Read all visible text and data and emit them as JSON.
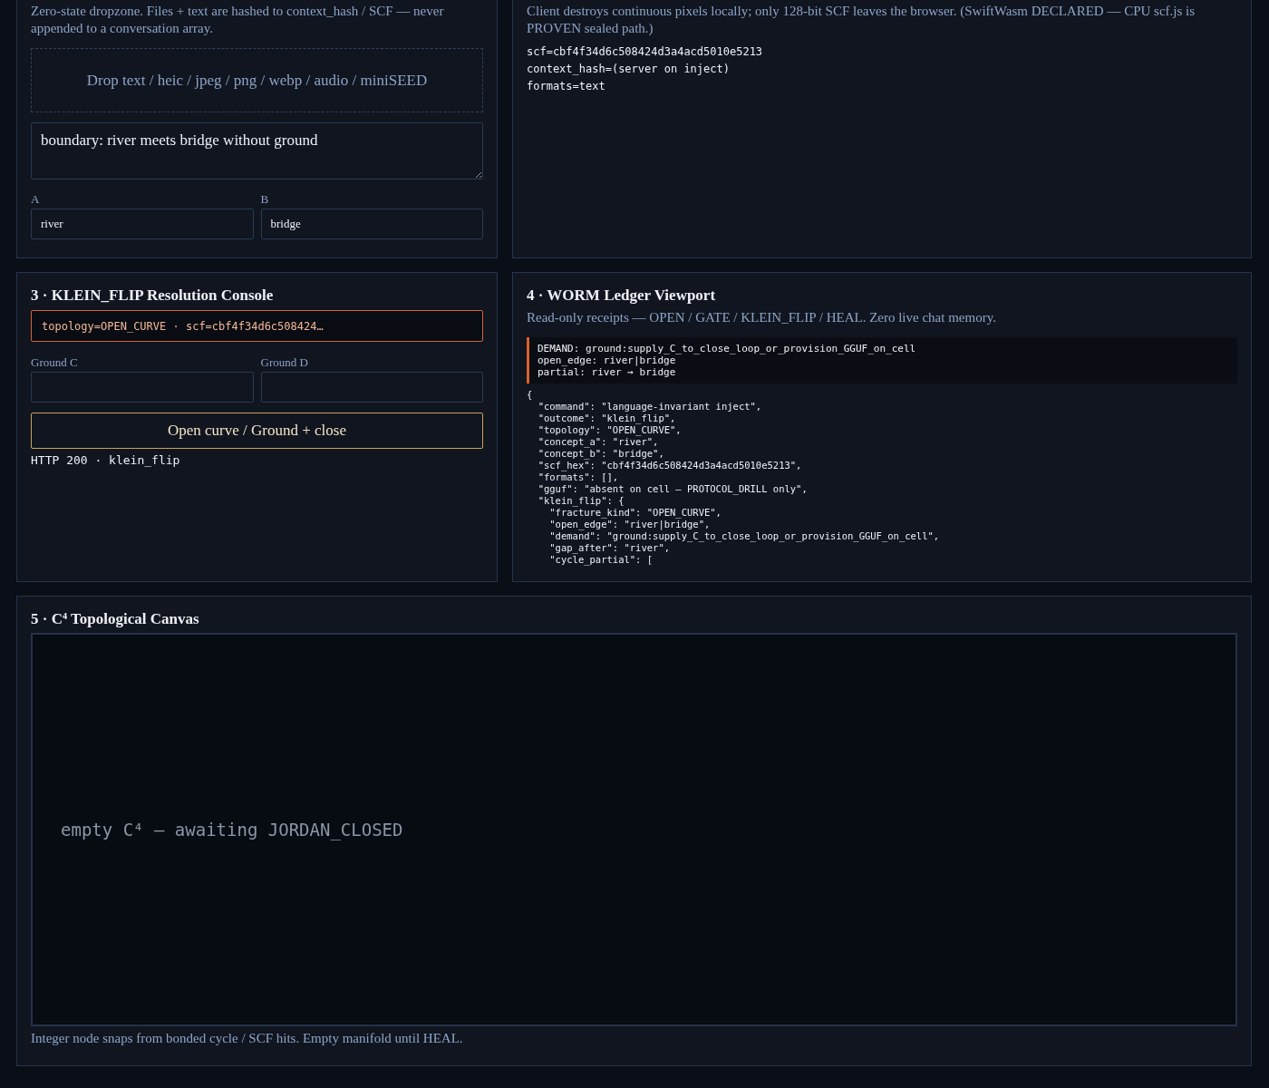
{
  "ingest_panel": {
    "description": "Zero-state dropzone. Files + text are hashed to context_hash / SCF — never appended to a conversation array.",
    "dropzone": "Drop text / heic / jpeg / png / webp / audio / miniSEED",
    "text": "boundary: river meets bridge without ground",
    "fields": [
      {
        "label": "A",
        "value": "river"
      },
      {
        "label": "B",
        "value": "bridge"
      }
    ]
  },
  "scf_panel": {
    "description": "Client destroys continuous pixels locally; only 128-bit SCF leaves the browser. (SwiftWasm DECLARED — CPU scf.js is PROVEN sealed path.)",
    "output_lines": [
      "scf=cbf4f34d6c508424d3a4acd5010e5213",
      "context_hash=(server on inject)",
      "formats=text"
    ]
  },
  "console_panel": {
    "title": "3 · KLEIN_FLIP Resolution Console",
    "alert": "topology=OPEN_CURVE · scf=cbf4f34d6c508424…",
    "fields": [
      {
        "label": "Ground C"
      },
      {
        "label": "Ground D"
      }
    ],
    "button": "Open curve / Ground + close",
    "status": "HTTP 200 · klein_flip"
  },
  "ledger_panel": {
    "title": "4 · WORM Ledger Viewport",
    "description": "Read-only receipts — OPEN / GATE / KLEIN_FLIP / HEAL. Zero live chat memory.",
    "demand_lines": [
      "DEMAND: ground:supply_C_to_close_loop_or_provision_GGUF_on_cell",
      "open_edge: river|bridge",
      "partial: river → bridge"
    ],
    "receipt_lines": [
      "{",
      "  \"command\": \"language-invariant inject\",",
      "  \"outcome\": \"klein_flip\",",
      "  \"topology\": \"OPEN_CURVE\",",
      "  \"concept_a\": \"river\",",
      "  \"concept_b\": \"bridge\",",
      "  \"scf_hex\": \"cbf4f34d6c508424d3a4acd5010e5213\",",
      "  \"formats\": [],",
      "  \"gguf\": \"absent on cell — PROTOCOL_DRILL only\",",
      "  \"klein_flip\": {",
      "    \"fracture_kind\": \"OPEN_CURVE\",",
      "    \"open_edge\": \"river|bridge\",",
      "    \"demand\": \"ground:supply_C_to_close_loop_or_provision_GGUF_on_cell\",",
      "    \"gap_after\": \"river\",",
      "    \"cycle_partial\": ["
    ]
  },
  "canvas_panel": {
    "title": "5 · C⁴ Topological Canvas",
    "canvas_message": "empty C⁴ — awaiting JORDAN_CLOSED",
    "caption": "Integer node snaps from bonded cycle / SCF hits. Empty manifold until HEAL."
  }
}
